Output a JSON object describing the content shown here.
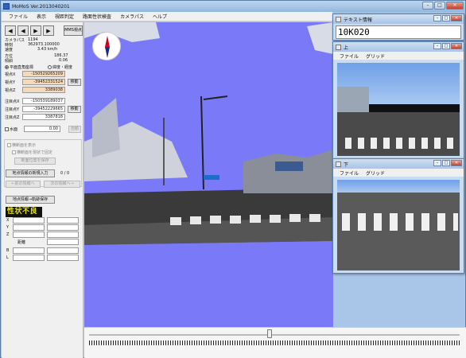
{
  "window": {
    "title": "MoMoS  Ver.2013040201"
  },
  "menu": [
    "ファイル",
    "表示",
    "視距判定",
    "路面性状検査",
    "カメラパス",
    "ヘルプ"
  ],
  "nav": {
    "buttons": [
      "◀",
      "◀",
      "▶",
      "▶"
    ],
    "mms_label": "MMS視点"
  },
  "camera_info": {
    "rows": [
      {
        "label": "カメラパス",
        "value": "1194"
      },
      {
        "label": "時刻",
        "value": "362973.100000"
      },
      {
        "label": "速度",
        "value": "3.43 km/h"
      }
    ],
    "rows2": [
      {
        "label": "方位",
        "value": "186.37"
      },
      {
        "label": "傾斜",
        "value": "0.06"
      }
    ]
  },
  "coord_mode": {
    "option1": "平面直角座標",
    "option2": "緯度・経度"
  },
  "viewpoint": {
    "x_label": "視点X",
    "x_value": "-150529265209",
    "y_label": "視点Y",
    "y_value": "-39452331524",
    "z_label": "視点Z",
    "z_value": "3389038",
    "move_label": "移動"
  },
  "target": {
    "x_label": "注目点X",
    "x_value": "-150539189037",
    "y_label": "注目点Y",
    "y_value": "-39452229665",
    "z_label": "注目点Z",
    "z_value": "3387818",
    "move_label": "移動"
  },
  "water": {
    "label": "水面",
    "value": "0.00",
    "auto_label": "自動"
  },
  "section": {
    "show_label": "横断面を表示",
    "fix_label": "横断面を現状で固定",
    "save_label": "断面位置を保存"
  },
  "location": {
    "input_label": "地点情報の新規入力",
    "count": "0 / 0",
    "prev_label": "←前の情報へ",
    "next_label": "次の情報へ→",
    "save_label": "地点情報→軌跡保存"
  },
  "status_badge": "性状不良",
  "measure_labels": {
    "x": "X",
    "y": "Y",
    "z": "Z",
    "distance": "距離",
    "b": "B",
    "l": "L"
  },
  "text_window": {
    "title": "テキスト情報",
    "text": "10K020"
  },
  "top_window": {
    "title": "上",
    "menu": [
      "ファイル",
      "グリッド"
    ]
  },
  "bottom_window": {
    "title": "下",
    "menu": [
      "ファイル",
      "グリッド"
    ]
  },
  "compass": {
    "label": "N"
  }
}
